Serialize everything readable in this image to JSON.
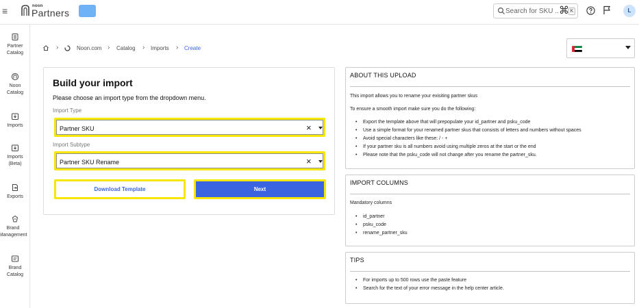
{
  "header": {
    "brand_small": "noon",
    "brand": "Partners",
    "search_placeholder": "Search for SKU ...",
    "shortcut_glyph": "⌘",
    "shortcut_key": "K",
    "avatar_initial": "L"
  },
  "sidebar": {
    "items": [
      {
        "label": "Partner Catalog",
        "icon": "tag-stack-icon"
      },
      {
        "label": "Noon Catalog",
        "icon": "noon-catalog-icon"
      },
      {
        "label": "Imports",
        "icon": "import-icon"
      },
      {
        "label": "Imports (Beta)",
        "icon": "import-beta-icon"
      },
      {
        "label": "Exports",
        "icon": "export-icon"
      },
      {
        "label": "Brand Management",
        "icon": "brand-management-icon"
      },
      {
        "label": "Brand Catalog",
        "icon": "brand-catalog-icon"
      }
    ]
  },
  "breadcrumb": {
    "items": [
      "Noon.com",
      "Catalog",
      "Imports",
      "Create"
    ]
  },
  "country": {
    "flag": "uae-flag-icon",
    "colors": {
      "red": "#e21f26",
      "green": "#00843d",
      "black": "#000000"
    }
  },
  "build": {
    "title": "Build your import",
    "subtitle": "Please choose an import type from the dropdown menu.",
    "type_label": "Import Type",
    "type_value": "Partner SKU",
    "subtype_label": "Import Subtype",
    "subtype_value": "Partner SKU Rename",
    "download_label": "Download Template",
    "next_label": "Next"
  },
  "about": {
    "title": "ABOUT THIS UPLOAD",
    "intro": "This import allows you to rename your exisiting partner skus",
    "lead": "To ensure a smooth import make sure you do the following:",
    "steps": [
      "Export the template above that will prepopulate your id_partner and psku_code",
      "Use a simple format for your renamed partner skus that consists of letters and numbers without spaces",
      "Avoid special characters like these: / - +",
      "If your partner sku is all numbers avoid using multiple zeros at the start or the end",
      "Please note that the psku_code will not change after you rename the partner_sku."
    ]
  },
  "columns": {
    "title": "IMPORT COLUMNS",
    "lead": "Mandatory columns",
    "items": [
      "id_partner",
      "psku_code",
      "rename_partner_sku"
    ]
  },
  "tips": {
    "title": "TIPS",
    "items": [
      "For imports up to 500 rows use the paste feature",
      "Search for the text of your error message in the help center article."
    ]
  },
  "colors": {
    "accent": "#3a64e0",
    "highlight": "#f6e700",
    "link": "#3866df"
  }
}
